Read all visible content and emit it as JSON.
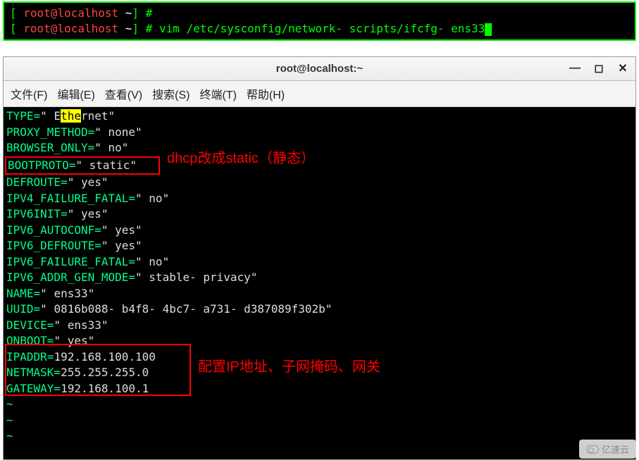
{
  "top_terminal": {
    "line1_prefix": "[",
    "line1_user": " root@localhost ",
    "line1_path": "~",
    "line1_suffix": "] #",
    "line2_prefix": "[",
    "line2_user": " root@localhost ",
    "line2_path": "~",
    "line2_suffix": "] # ",
    "line2_cmd": "vim /etc/sysconfig/network- scripts/ifcfg- ens33"
  },
  "window": {
    "title": "root@localhost:~",
    "controls": {
      "min": "—",
      "max": "◻",
      "close": "✕"
    }
  },
  "menubar": {
    "items": [
      "文件(F)",
      "编辑(E)",
      "查看(V)",
      "搜索(S)",
      "终端(T)",
      "帮助(H)"
    ]
  },
  "config": {
    "line1_key_pre": "TYPE=",
    "line1_val_pre": "\" E",
    "line1_hl": "the",
    "line1_val_post": "rnet\"",
    "lines": [
      {
        "key": "PROXY_METHOD=",
        "val": "\" none\""
      },
      {
        "key": "BROWSER_ONLY=",
        "val": "\" no\""
      }
    ],
    "bootproto_key": "BOOTPROTO=",
    "bootproto_val": "\" static\"",
    "lines2": [
      {
        "key": "DEFROUTE=",
        "val": "\" yes\""
      },
      {
        "key": "IPV4_FAILURE_FATAL=",
        "val": "\" no\""
      },
      {
        "key": "IPV6INIT=",
        "val": "\" yes\""
      },
      {
        "key": "IPV6_AUTOCONF=",
        "val": "\" yes\""
      },
      {
        "key": "IPV6_DEFROUTE=",
        "val": "\" yes\""
      },
      {
        "key": "IPV6_FAILURE_FATAL=",
        "val": "\" no\""
      },
      {
        "key": "IPV6_ADDR_GEN_MODE=",
        "val": "\" stable- privacy\""
      },
      {
        "key": "NAME=",
        "val": "\" ens33\""
      },
      {
        "key": "UUID=",
        "val": "\" 0816b088- b4f8- 4bc7- a731- d387089f302b\""
      },
      {
        "key": "DEVICE=",
        "val": "\" ens33\""
      },
      {
        "key": "ONBOOT=",
        "val": "\" yes\""
      }
    ],
    "iplines": [
      {
        "key": "IPADDR=",
        "val": "192.168.100.100"
      },
      {
        "key": "NETMASK=",
        "val": "255.255.255.0"
      },
      {
        "key": "GATEWAY=",
        "val": "192.168.100.1"
      }
    ],
    "tilde": "~"
  },
  "annotations": {
    "a1": "dhcp改成static（静态）",
    "a2": "配置IP地址、子网掩码、网关"
  },
  "watermark": "亿速云"
}
